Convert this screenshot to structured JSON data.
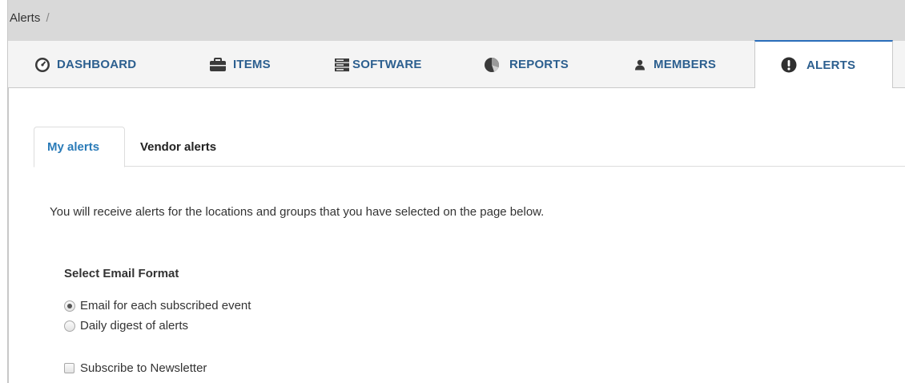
{
  "breadcrumb": {
    "current": "Alerts",
    "separator": "/"
  },
  "nav": {
    "items": [
      {
        "label": "DASHBOARD",
        "icon": "dashboard-gauge-icon"
      },
      {
        "label": "ITEMS",
        "icon": "briefcase-icon"
      },
      {
        "label": "SOFTWARE",
        "icon": "server-stack-icon"
      },
      {
        "label": "REPORTS",
        "icon": "pie-chart-icon"
      },
      {
        "label": "MEMBERS",
        "icon": "user-icon"
      },
      {
        "label": "ALERTS",
        "icon": "exclamation-circle-icon"
      }
    ],
    "active": "ALERTS"
  },
  "tabs": {
    "items": [
      {
        "label": "My alerts"
      },
      {
        "label": "Vendor alerts"
      }
    ],
    "active": "My alerts"
  },
  "main": {
    "intro": "You will receive alerts for the locations and groups that you have selected on the page below.",
    "email_format": {
      "title": "Select Email Format",
      "options": [
        {
          "label": "Email for each subscribed event",
          "selected": true
        },
        {
          "label": "Daily digest of alerts",
          "selected": false
        }
      ]
    },
    "newsletter": {
      "label": "Subscribe to Newsletter",
      "checked": false
    }
  },
  "colors": {
    "nav_text": "#2c5f8f",
    "active_accent": "#2a6ebb",
    "breadcrumb_bg": "#d9d9d9",
    "nav_bg": "#f4f4f4"
  }
}
